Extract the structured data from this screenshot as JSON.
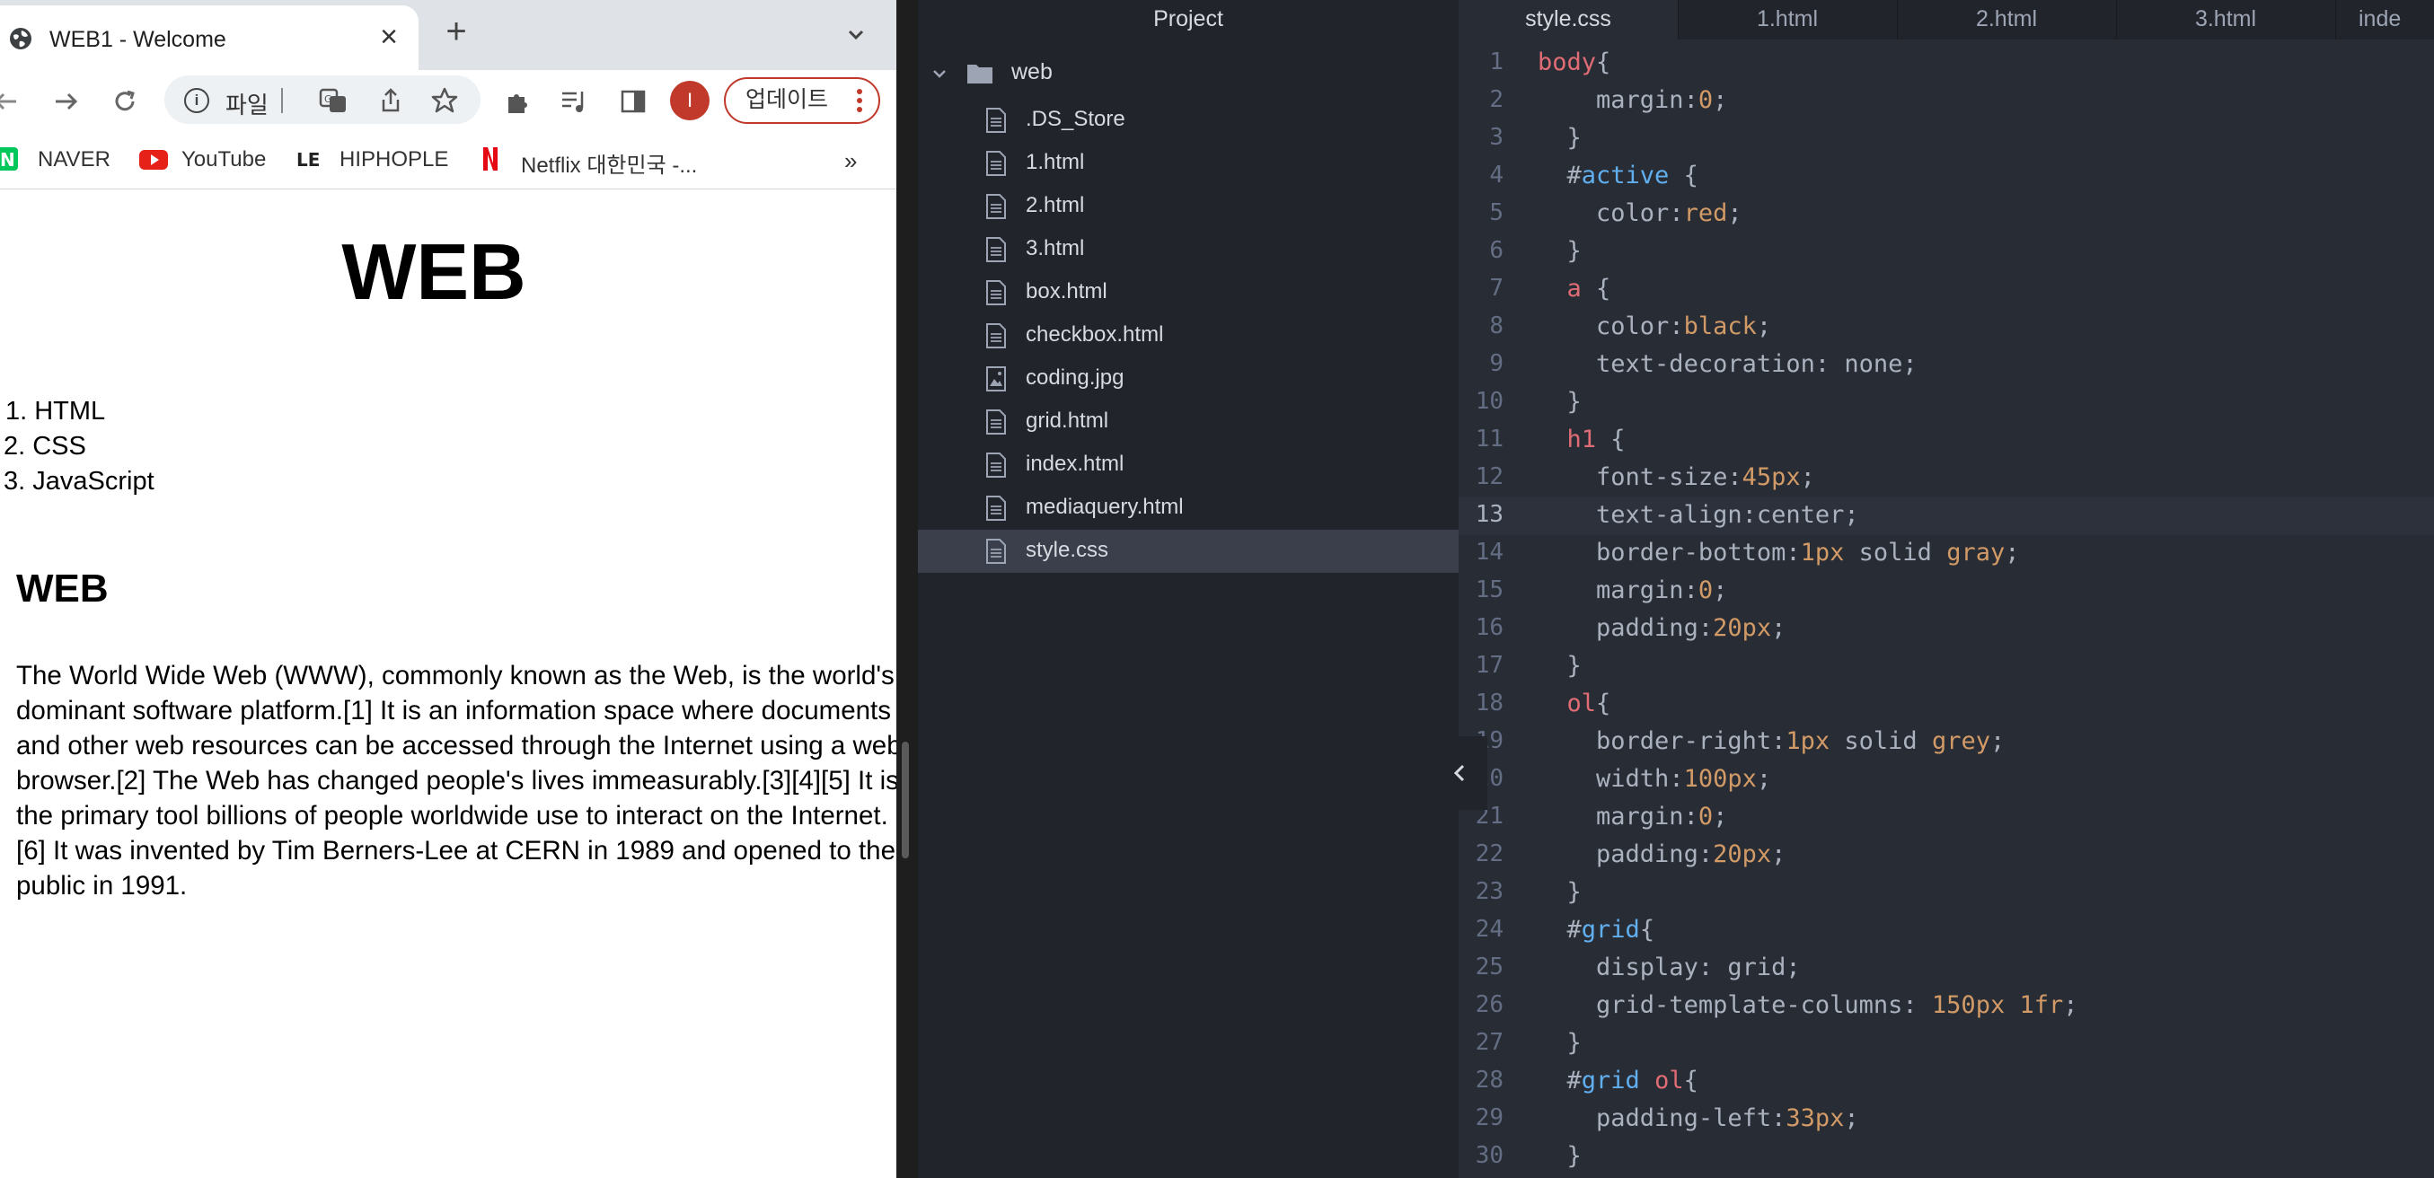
{
  "browser": {
    "tab_title": "WEB1 - Welcome",
    "omnibox_text": "파일",
    "avatar_letter": "I",
    "update_label": "업데이트",
    "bookmarks": [
      "NAVER",
      "YouTube",
      "HIPHOPLE",
      "Netflix 대한민국 -..."
    ],
    "bookmarks_overflow": "»"
  },
  "page": {
    "h1": "WEB",
    "list": [
      "1. HTML",
      "2. CSS",
      "3. JavaScript"
    ],
    "h2": "WEB",
    "paragraph": "The World Wide Web (WWW), commonly known as the Web, is the world's dominant software platform.[1] It is an information space where documents and other web resources can be accessed through the Internet using a web browser.[2] The Web has changed people's lives immeasurably.[3][4][5] It is the primary tool billions of people worldwide use to interact on the Internet.[6] It was invented by Tim Berners-Lee at CERN in 1989 and opened to the public in 1991."
  },
  "tree": {
    "header": "Project",
    "root": "web",
    "files": [
      {
        "name": ".DS_Store",
        "icon": "file-text-icon"
      },
      {
        "name": "1.html",
        "icon": "file-text-icon"
      },
      {
        "name": "2.html",
        "icon": "file-text-icon"
      },
      {
        "name": "3.html",
        "icon": "file-text-icon"
      },
      {
        "name": "box.html",
        "icon": "file-text-icon"
      },
      {
        "name": "checkbox.html",
        "icon": "file-text-icon"
      },
      {
        "name": "coding.jpg",
        "icon": "file-image-icon"
      },
      {
        "name": "grid.html",
        "icon": "file-text-icon"
      },
      {
        "name": "index.html",
        "icon": "file-text-icon"
      },
      {
        "name": "mediaquery.html",
        "icon": "file-text-icon"
      },
      {
        "name": "style.css",
        "icon": "file-text-icon",
        "selected": true
      }
    ]
  },
  "editor": {
    "tabs": [
      "style.css",
      "1.html",
      "2.html",
      "3.html",
      "inde"
    ],
    "active_tab": "style.css",
    "current_line": 13,
    "lines": [
      [
        [
          "tag",
          "body"
        ],
        [
          "p",
          "{"
        ]
      ],
      [
        [
          "p",
          "    "
        ],
        [
          "prop",
          "margin"
        ],
        [
          "p",
          ":"
        ],
        [
          "num",
          "0"
        ],
        [
          "p",
          ";"
        ]
      ],
      [
        [
          "p",
          "  }"
        ]
      ],
      [
        [
          "p",
          "  "
        ],
        [
          "p",
          "#"
        ],
        [
          "id",
          "active"
        ],
        [
          "p",
          " {"
        ]
      ],
      [
        [
          "p",
          "    "
        ],
        [
          "prop",
          "color"
        ],
        [
          "p",
          ":"
        ],
        [
          "val",
          "red"
        ],
        [
          "p",
          ";"
        ]
      ],
      [
        [
          "p",
          "  }"
        ]
      ],
      [
        [
          "p",
          "  "
        ],
        [
          "tag",
          "a"
        ],
        [
          "p",
          " {"
        ]
      ],
      [
        [
          "p",
          "    "
        ],
        [
          "prop",
          "color"
        ],
        [
          "p",
          ":"
        ],
        [
          "val",
          "black"
        ],
        [
          "p",
          ";"
        ]
      ],
      [
        [
          "p",
          "    "
        ],
        [
          "prop",
          "text-decoration"
        ],
        [
          "p",
          ": none;"
        ]
      ],
      [
        [
          "p",
          "  }"
        ]
      ],
      [
        [
          "p",
          "  "
        ],
        [
          "tag",
          "h1"
        ],
        [
          "p",
          " {"
        ]
      ],
      [
        [
          "p",
          "    "
        ],
        [
          "prop",
          "font-size"
        ],
        [
          "p",
          ":"
        ],
        [
          "num",
          "45px"
        ],
        [
          "p",
          ";"
        ]
      ],
      [
        [
          "p",
          "    "
        ],
        [
          "prop",
          "text-align"
        ],
        [
          "p",
          ":center;"
        ]
      ],
      [
        [
          "p",
          "    "
        ],
        [
          "prop",
          "border-bottom"
        ],
        [
          "p",
          ":"
        ],
        [
          "num",
          "1px"
        ],
        [
          "p",
          " solid "
        ],
        [
          "val",
          "gray"
        ],
        [
          "p",
          ";"
        ]
      ],
      [
        [
          "p",
          "    "
        ],
        [
          "prop",
          "margin"
        ],
        [
          "p",
          ":"
        ],
        [
          "num",
          "0"
        ],
        [
          "p",
          ";"
        ]
      ],
      [
        [
          "p",
          "    "
        ],
        [
          "prop",
          "padding"
        ],
        [
          "p",
          ":"
        ],
        [
          "num",
          "20px"
        ],
        [
          "p",
          ";"
        ]
      ],
      [
        [
          "p",
          "  }"
        ]
      ],
      [
        [
          "p",
          "  "
        ],
        [
          "tag",
          "ol"
        ],
        [
          "p",
          "{"
        ]
      ],
      [
        [
          "p",
          "    "
        ],
        [
          "prop",
          "border-right"
        ],
        [
          "p",
          ":"
        ],
        [
          "num",
          "1px"
        ],
        [
          "p",
          " solid "
        ],
        [
          "val",
          "grey"
        ],
        [
          "p",
          ";"
        ]
      ],
      [
        [
          "p",
          "    "
        ],
        [
          "prop",
          "width"
        ],
        [
          "p",
          ":"
        ],
        [
          "num",
          "100px"
        ],
        [
          "p",
          ";"
        ]
      ],
      [
        [
          "p",
          "    "
        ],
        [
          "prop",
          "margin"
        ],
        [
          "p",
          ":"
        ],
        [
          "num",
          "0"
        ],
        [
          "p",
          ";"
        ]
      ],
      [
        [
          "p",
          "    "
        ],
        [
          "prop",
          "padding"
        ],
        [
          "p",
          ":"
        ],
        [
          "num",
          "20px"
        ],
        [
          "p",
          ";"
        ]
      ],
      [
        [
          "p",
          "  }"
        ]
      ],
      [
        [
          "p",
          "  "
        ],
        [
          "p",
          "#"
        ],
        [
          "id",
          "grid"
        ],
        [
          "p",
          "{"
        ]
      ],
      [
        [
          "p",
          "    "
        ],
        [
          "prop",
          "display"
        ],
        [
          "p",
          ": grid;"
        ]
      ],
      [
        [
          "p",
          "    "
        ],
        [
          "prop",
          "grid-template-columns"
        ],
        [
          "p",
          ": "
        ],
        [
          "num",
          "150px"
        ],
        [
          "p",
          " "
        ],
        [
          "num",
          "1fr"
        ],
        [
          "p",
          ";"
        ]
      ],
      [
        [
          "p",
          "  }"
        ]
      ],
      [
        [
          "p",
          "  "
        ],
        [
          "p",
          "#"
        ],
        [
          "id",
          "grid"
        ],
        [
          "p",
          " "
        ],
        [
          "tag",
          "ol"
        ],
        [
          "p",
          "{"
        ]
      ],
      [
        [
          "p",
          "    "
        ],
        [
          "prop",
          "padding-left"
        ],
        [
          "p",
          ":"
        ],
        [
          "num",
          "33px"
        ],
        [
          "p",
          ";"
        ]
      ],
      [
        [
          "p",
          "  }"
        ]
      ]
    ]
  },
  "colors": {
    "editor_bg": "#282c34",
    "tree_bg": "#21252b",
    "tag": "#e06c75",
    "id": "#61afef",
    "number": "#d19a66",
    "update_border": "#c0392b"
  }
}
